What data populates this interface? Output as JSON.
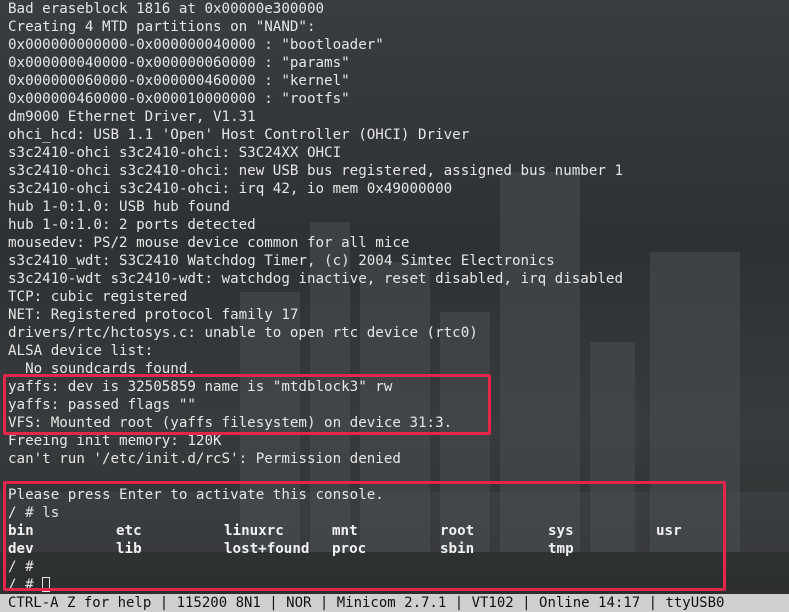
{
  "terminal": {
    "lines": [
      "Bad eraseblock 1816 at 0x00000e300000",
      "Creating 4 MTD partitions on \"NAND\":",
      "0x000000000000-0x000000040000 : \"bootloader\"",
      "0x000000040000-0x000000060000 : \"params\"",
      "0x000000060000-0x000000460000 : \"kernel\"",
      "0x000000460000-0x000010000000 : \"rootfs\"",
      "dm9000 Ethernet Driver, V1.31",
      "ohci_hcd: USB 1.1 'Open' Host Controller (OHCI) Driver",
      "s3c2410-ohci s3c2410-ohci: S3C24XX OHCI",
      "s3c2410-ohci s3c2410-ohci: new USB bus registered, assigned bus number 1",
      "s3c2410-ohci s3c2410-ohci: irq 42, io mem 0x49000000",
      "hub 1-0:1.0: USB hub found",
      "hub 1-0:1.0: 2 ports detected",
      "mousedev: PS/2 mouse device common for all mice",
      "s3c2410_wdt: S3C2410 Watchdog Timer, (c) 2004 Simtec Electronics",
      "s3c2410-wdt s3c2410-wdt: watchdog inactive, reset disabled, irq disabled",
      "TCP: cubic registered",
      "NET: Registered protocol family 17",
      "drivers/rtc/hctosys.c: unable to open rtc device (rtc0)",
      "ALSA device list:",
      "  No soundcards found.",
      "yaffs: dev is 32505859 name is \"mtdblock3\" rw",
      "yaffs: passed flags \"\"",
      "VFS: Mounted root (yaffs filesystem) on device 31:3.",
      "Freeing init memory: 120K",
      "can't run '/etc/init.d/rcS': Permission denied",
      "",
      "Please press Enter to activate this console.",
      "/ # ls"
    ],
    "ls_rows": [
      [
        "bin",
        "etc",
        "linuxrc",
        "mnt",
        "root",
        "sys",
        "usr"
      ],
      [
        "dev",
        "lib",
        "lost+found",
        "proc",
        "sbin",
        "tmp",
        ""
      ]
    ],
    "prompt_lines": [
      "/ #",
      "/ # "
    ]
  },
  "status_bar": {
    "text": "CTRL-A Z for help | 115200 8N1 | NOR | Minicom 2.7.1 | VT102 | Online 14:17 | ttyUSB0"
  },
  "colors": {
    "highlight": "#e3264a",
    "terminal_text": "#e6e6e6",
    "status_bg": "#cfcfcf"
  }
}
